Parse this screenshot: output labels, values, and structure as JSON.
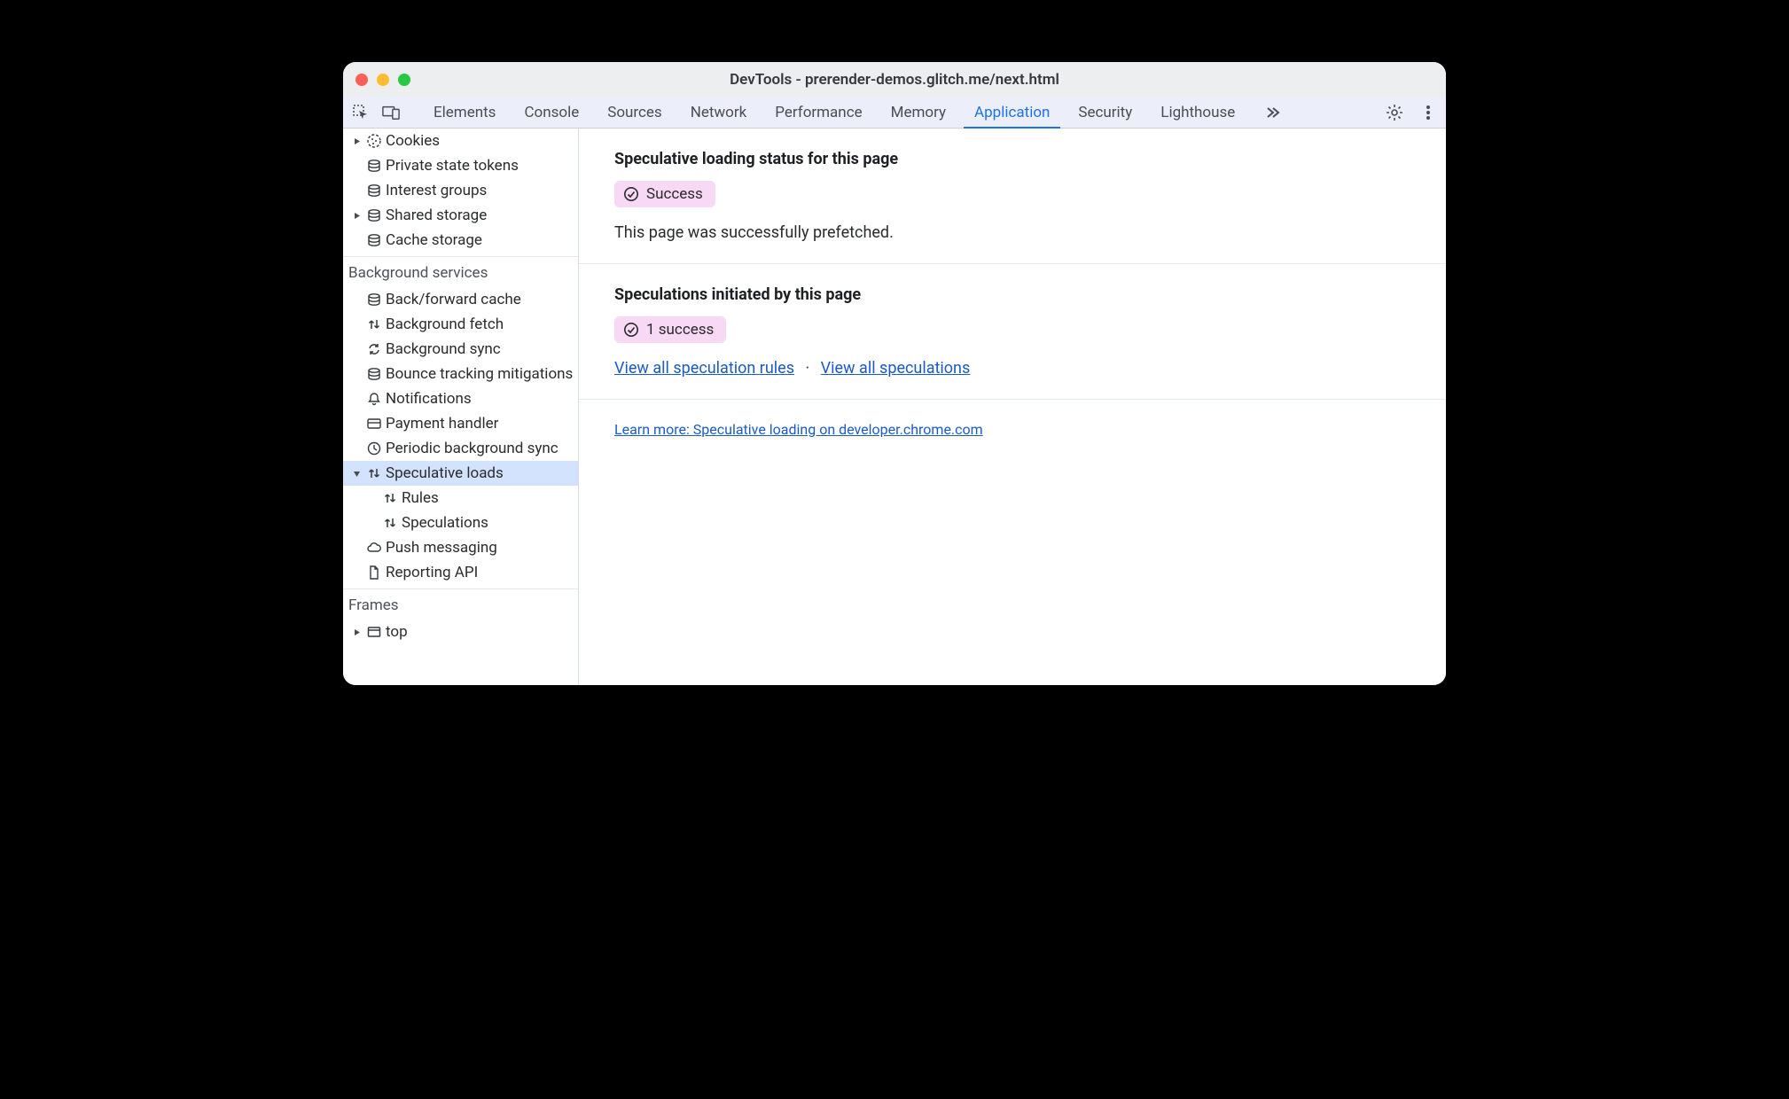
{
  "window": {
    "title": "DevTools - prerender-demos.glitch.me/next.html"
  },
  "tabs": [
    "Elements",
    "Console",
    "Sources",
    "Network",
    "Performance",
    "Memory",
    "Application",
    "Security",
    "Lighthouse"
  ],
  "active_tab": "Application",
  "sidebar": {
    "storage_items": [
      {
        "label": "Cookies",
        "icon": "cookie",
        "has_children": true
      },
      {
        "label": "Private state tokens",
        "icon": "db",
        "has_children": false
      },
      {
        "label": "Interest groups",
        "icon": "db",
        "has_children": false
      },
      {
        "label": "Shared storage",
        "icon": "db",
        "has_children": true
      },
      {
        "label": "Cache storage",
        "icon": "db",
        "has_children": false
      }
    ],
    "bg_title": "Background services",
    "bg_items": [
      {
        "label": "Back/forward cache",
        "icon": "db"
      },
      {
        "label": "Background fetch",
        "icon": "updown"
      },
      {
        "label": "Background sync",
        "icon": "sync"
      },
      {
        "label": "Bounce tracking mitigations",
        "icon": "db"
      },
      {
        "label": "Notifications",
        "icon": "bell"
      },
      {
        "label": "Payment handler",
        "icon": "card"
      },
      {
        "label": "Periodic background sync",
        "icon": "clock"
      },
      {
        "label": "Speculative loads",
        "icon": "updown",
        "has_children": true,
        "selected": true
      },
      {
        "label": "Rules",
        "icon": "updown",
        "child": true
      },
      {
        "label": "Speculations",
        "icon": "updown",
        "child": true
      },
      {
        "label": "Push messaging",
        "icon": "cloud"
      },
      {
        "label": "Reporting API",
        "icon": "doc"
      }
    ],
    "frames_title": "Frames",
    "frames_items": [
      {
        "label": "top",
        "icon": "frame",
        "has_children": true
      }
    ]
  },
  "main": {
    "section1": {
      "title": "Speculative loading status for this page",
      "badge": "Success",
      "body": "This page was successfully prefetched."
    },
    "section2": {
      "title": "Speculations initiated by this page",
      "badge": "1 success",
      "link_rules": "View all speculation rules",
      "link_specs": "View all speculations"
    },
    "learn_more": "Learn more: Speculative loading on developer.chrome.com"
  }
}
